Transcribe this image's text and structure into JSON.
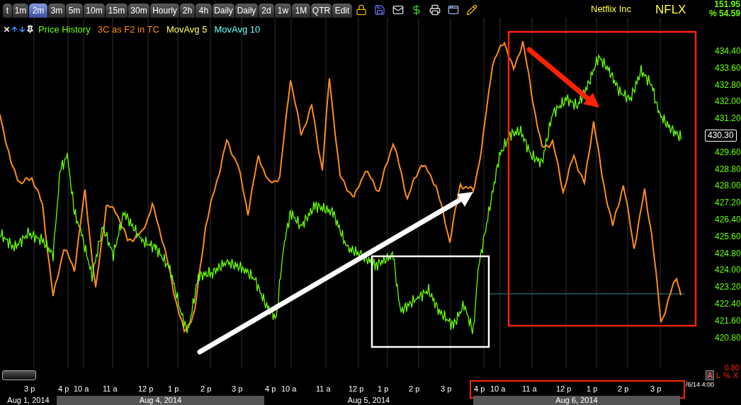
{
  "toolbar": {
    "tabs": [
      {
        "label": "t",
        "selected": false
      },
      {
        "label": "1m",
        "selected": false
      },
      {
        "label": "2m",
        "selected": true
      },
      {
        "label": "3m",
        "selected": false
      },
      {
        "label": "5m",
        "selected": false
      },
      {
        "label": "10m",
        "selected": false
      },
      {
        "label": "15m",
        "selected": false
      },
      {
        "label": "30m",
        "selected": false
      },
      {
        "label": "Hourly",
        "selected": false
      },
      {
        "label": "2h",
        "selected": false
      },
      {
        "label": "4h",
        "selected": false
      },
      {
        "label": "Daily",
        "selected": false
      },
      {
        "label": "Daily",
        "selected": false
      },
      {
        "label": "2d",
        "selected": false
      },
      {
        "label": "1w",
        "selected": false
      },
      {
        "label": "1M",
        "selected": false
      },
      {
        "label": "QTR",
        "selected": false
      },
      {
        "label": "Edit",
        "selected": false
      }
    ]
  },
  "header": {
    "company": "Netflix Inc",
    "symbol": "NFLX",
    "price": "151.95",
    "change": "% 54.59"
  },
  "legend": [
    {
      "label": "Price History",
      "color": "#66ff00"
    },
    {
      "label": "3C as F2 in TC",
      "color": "#ff8c00"
    },
    {
      "label": "MovAvg 5",
      "color": "#ffff66"
    },
    {
      "label": "MovAvg 10",
      "color": "#66ffff"
    }
  ],
  "chart": {
    "y_axis": [
      "434.40",
      "433.60",
      "432.80",
      "432.00",
      "431.20",
      "429.60",
      "428.80",
      "428.00",
      "427.20",
      "426.40",
      "425.60",
      "424.80",
      "424.00",
      "423.20",
      "422.40",
      "421.60",
      "420.80"
    ],
    "current_price": "430.30",
    "indicator_value": "0.80",
    "scale_buttons": [
      "A",
      "L",
      "%",
      "X"
    ],
    "x_axis": [
      "3 p",
      "4 p",
      "10 a",
      "11 a",
      "12 p",
      "1 p",
      "2 p",
      "3 p",
      "4 p",
      "10 a",
      "11 a",
      "12 p",
      "1 p",
      "2 p",
      "3 p",
      "4 p",
      "10 a",
      "11 a",
      "12 p",
      "1 p",
      "2 p",
      "3 p"
    ],
    "end_time": "/6/14 4:00",
    "dates": [
      {
        "label": "Aug 1, 2014",
        "shaded": false
      },
      {
        "label": "Aug 4, 2014",
        "shaded": true
      },
      {
        "label": "Aug 5, 2014",
        "shaded": false
      },
      {
        "label": "Aug 6, 2014",
        "shaded": true
      }
    ]
  }
}
